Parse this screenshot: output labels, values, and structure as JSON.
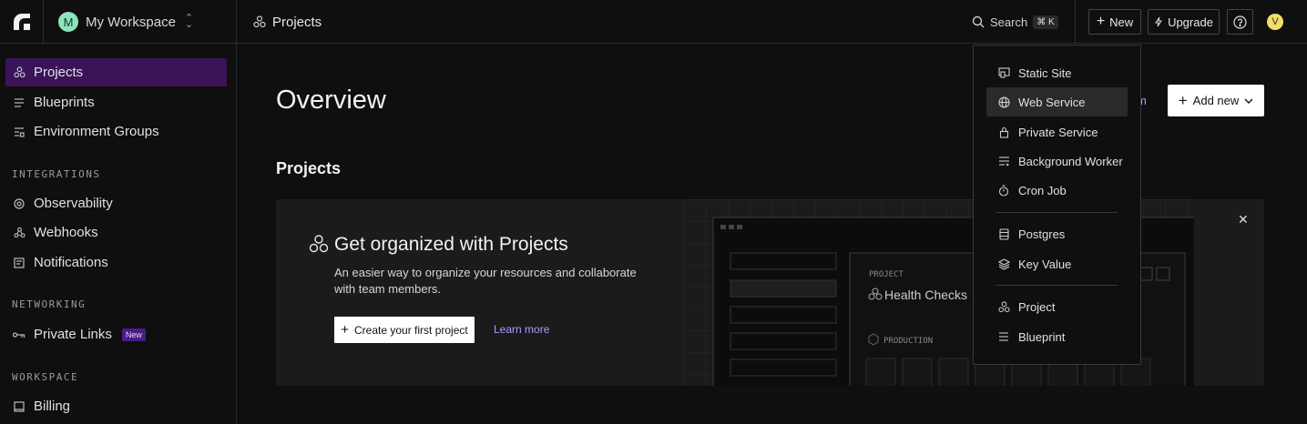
{
  "topbar": {
    "workspace_initial": "M",
    "workspace_name": "My Workspace",
    "breadcrumb": "Projects",
    "search_label": "Search",
    "search_shortcut": "⌘ K",
    "new_label": "New",
    "upgrade_label": "Upgrade",
    "user_initial": "V"
  },
  "sidebar": {
    "items_top": [
      {
        "label": "Projects",
        "icon": "projects-icon"
      },
      {
        "label": "Blueprints",
        "icon": "list-icon"
      },
      {
        "label": "Environment Groups",
        "icon": "env-icon"
      }
    ],
    "integrations_heading": "INTEGRATIONS",
    "integrations": [
      {
        "label": "Observability",
        "icon": "observability-icon"
      },
      {
        "label": "Webhooks",
        "icon": "webhook-icon"
      },
      {
        "label": "Notifications",
        "icon": "notification-icon"
      }
    ],
    "networking_heading": "NETWORKING",
    "private_links": "Private Links",
    "new_badge": "New",
    "workspace_heading": "WORKSPACE",
    "billing": "Billing"
  },
  "main": {
    "title": "Overview",
    "partial_link": "m",
    "add_new_label": "Add new",
    "projects_heading": "Projects",
    "card": {
      "title": "Get organized with Projects",
      "description": "An easier way to organize your resources and collaborate with team members.",
      "create_label": "Create your first project",
      "learn_more": "Learn more",
      "illustration": {
        "project_label": "PROJECT",
        "project_name": "Health Checks",
        "env_label": "PRODUCTION"
      }
    }
  },
  "dropdown": {
    "group1": [
      {
        "label": "Static Site"
      },
      {
        "label": "Web Service"
      },
      {
        "label": "Private Service"
      },
      {
        "label": "Background Worker"
      },
      {
        "label": "Cron Job"
      }
    ],
    "group2": [
      {
        "label": "Postgres"
      },
      {
        "label": "Key Value"
      }
    ],
    "group3": [
      {
        "label": "Project"
      },
      {
        "label": "Blueprint"
      }
    ]
  },
  "colors": {
    "accent_purple": "#3a1358",
    "link_purple": "#b497ff",
    "workspace_avatar": "#8fe3bb",
    "user_avatar": "#f3de6b"
  }
}
